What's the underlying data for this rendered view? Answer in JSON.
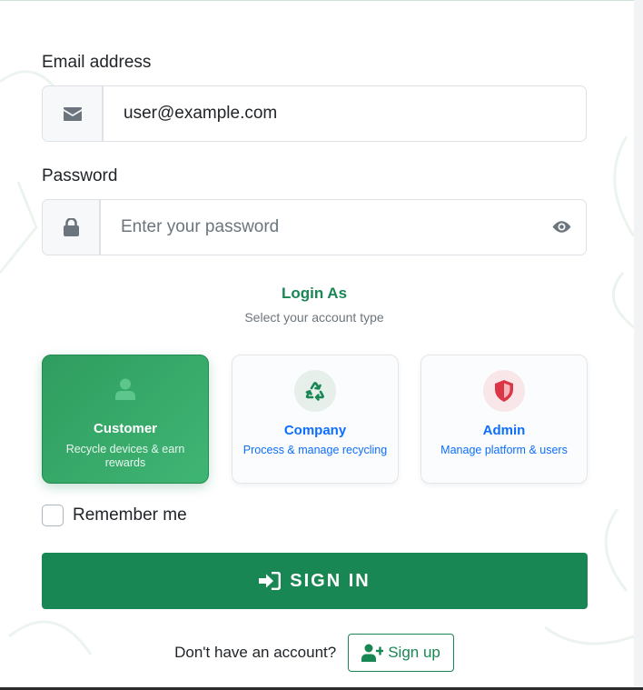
{
  "email": {
    "label": "Email address",
    "value": "user@example.com",
    "icon": "envelope-icon"
  },
  "password": {
    "label": "Password",
    "placeholder": "Enter your password",
    "icon": "lock-icon",
    "toggle_icon": "eye-icon"
  },
  "login_as": {
    "title": "Login As",
    "subtitle": "Select your account type",
    "selected": "Customer",
    "options": [
      {
        "title": "Customer",
        "description": "Recycle devices & earn rewards",
        "icon": "user-icon"
      },
      {
        "title": "Company",
        "description": "Process & manage recycling",
        "icon": "recycle-icon"
      },
      {
        "title": "Admin",
        "description": "Manage platform & users",
        "icon": "shield-icon"
      }
    ]
  },
  "remember": {
    "label": "Remember me",
    "checked": false
  },
  "signin": {
    "label": "SIGN IN",
    "icon": "sign-in-icon"
  },
  "signup": {
    "question": "Don't have an account?",
    "label": "Sign up",
    "icon": "user-plus-icon"
  },
  "colors": {
    "primary": "#198754",
    "link": "#0d6efd",
    "danger": "#dc3545",
    "muted": "#6c757d"
  }
}
